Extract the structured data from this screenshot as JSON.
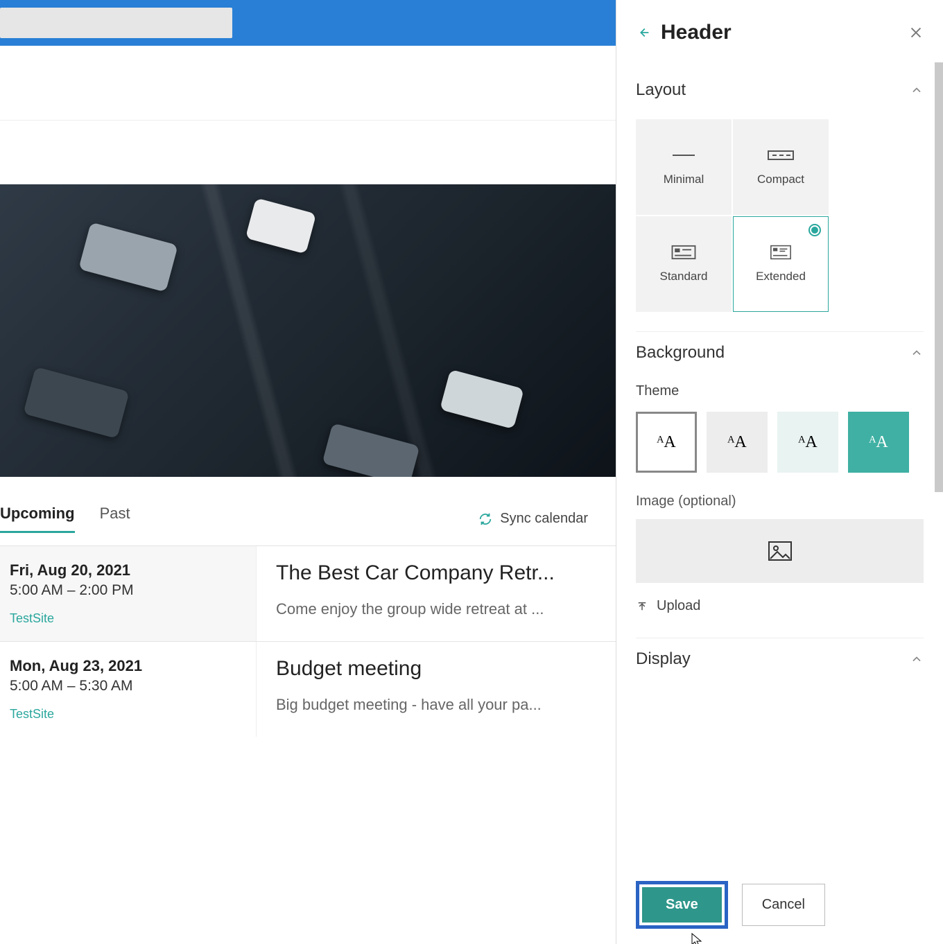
{
  "main": {
    "tabs": {
      "upcoming": "Upcoming",
      "past": "Past"
    },
    "sync_label": "Sync calendar",
    "events": [
      {
        "date": "Fri, Aug 20, 2021",
        "time": "5:00 AM – 2:00 PM",
        "site": "TestSite",
        "title": "The Best Car Company Retr...",
        "desc": "Come enjoy the group wide retreat at ..."
      },
      {
        "date": "Mon, Aug 23, 2021",
        "time": "5:00 AM – 5:30 AM",
        "site": "TestSite",
        "title": "Budget meeting",
        "desc": "Big budget meeting - have all your pa..."
      }
    ]
  },
  "panel": {
    "title": "Header",
    "sections": {
      "layout": {
        "label": "Layout",
        "options": [
          "Minimal",
          "Compact",
          "Standard",
          "Extended"
        ],
        "selected": "Extended"
      },
      "background": {
        "label": "Background",
        "theme_label": "Theme",
        "theme_swatch_text": "ᴬA",
        "image_label": "Image (optional)",
        "upload_label": "Upload"
      },
      "display": {
        "label": "Display"
      }
    },
    "buttons": {
      "save": "Save",
      "cancel": "Cancel"
    }
  }
}
